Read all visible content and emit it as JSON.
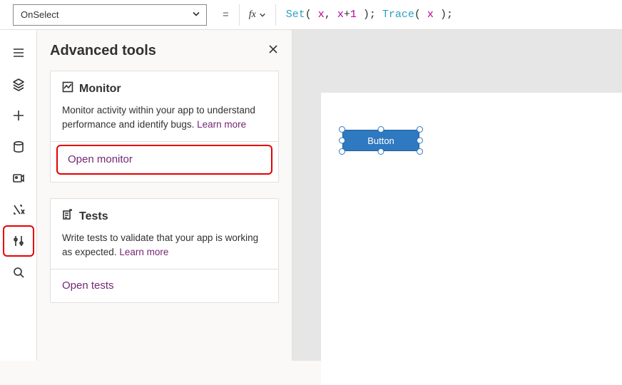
{
  "topbar": {
    "property": "OnSelect",
    "equals": "=",
    "fx": "fx",
    "formula_tokens": [
      {
        "t": "Set",
        "c": "fn"
      },
      {
        "t": "( ",
        "c": "sp"
      },
      {
        "t": "x",
        "c": "var"
      },
      {
        "t": ", ",
        "c": "sp"
      },
      {
        "t": "x",
        "c": "var"
      },
      {
        "t": "+",
        "c": "sp"
      },
      {
        "t": "1",
        "c": "var"
      },
      {
        "t": " ); ",
        "c": "sp"
      },
      {
        "t": "Trace",
        "c": "fn"
      },
      {
        "t": "( ",
        "c": "sp"
      },
      {
        "t": "x",
        "c": "var"
      },
      {
        "t": " );",
        "c": "sp"
      }
    ]
  },
  "rail": {
    "items": [
      {
        "name": "hamburger-icon"
      },
      {
        "name": "layers-icon"
      },
      {
        "name": "plus-icon"
      },
      {
        "name": "database-icon"
      },
      {
        "name": "media-icon"
      },
      {
        "name": "variables-icon"
      },
      {
        "name": "tools-icon",
        "highlight": true
      },
      {
        "name": "search-icon"
      }
    ]
  },
  "panel": {
    "title": "Advanced tools",
    "monitor": {
      "title": "Monitor",
      "desc": "Monitor activity within your app to understand performance and identify bugs. ",
      "learn": "Learn more",
      "action": "Open monitor"
    },
    "tests": {
      "title": "Tests",
      "desc": "Write tests to validate that your app is working as expected. ",
      "learn": "Learn more",
      "action": "Open tests"
    }
  },
  "canvas": {
    "button_label": "Button"
  }
}
